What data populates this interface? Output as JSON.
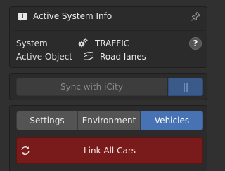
{
  "info": {
    "title": "Active System Info",
    "system_label": "System",
    "system_value": "TRAFFIC",
    "object_label": "Active Object",
    "object_value": "Road lanes",
    "help_label": "?"
  },
  "sync": {
    "sync_label": "Sync with iCity",
    "pause_label": "||"
  },
  "tabs": [
    {
      "label": "Settings",
      "active": false
    },
    {
      "label": "Environment",
      "active": false
    },
    {
      "label": "Vehicles",
      "active": true
    }
  ],
  "actions": {
    "link_all_cars_label": "Link All Cars"
  },
  "colors": {
    "background": "#303030",
    "panel": "#2b2b2b",
    "tab_active": "#4772b3",
    "pause_active": "#3a5a8a",
    "link_button": "#7a1b1b"
  },
  "icons": {
    "info": "info-bubble-icon",
    "pin": "pin-icon",
    "system": "settings-gear-icon",
    "object": "road-lanes-icon",
    "help": "question-mark-icon",
    "link": "sync-arrows-icon"
  }
}
